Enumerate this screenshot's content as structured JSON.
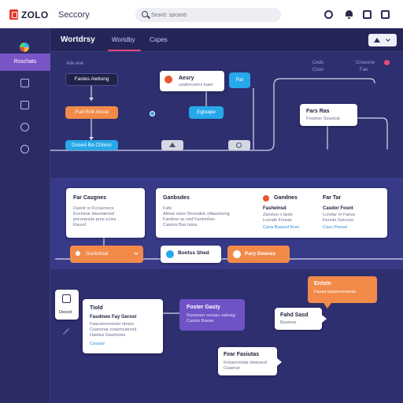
{
  "topbar": {
    "brand": "ZOLO",
    "nav_label": "Seccory",
    "search_placeholder": "Seard: spcanb"
  },
  "sidebar": {
    "active_label": "Rsschats"
  },
  "header": {
    "title": "Wortdrsy",
    "tabs": [
      {
        "label": "Wortdby"
      },
      {
        "label": "Cxpes"
      }
    ]
  },
  "canvas": {
    "lane_left": "Aite ene",
    "lane_right_a": "Ceds",
    "lane_right_b": "Coon",
    "lane_right_c": "Cnseone",
    "lane_right_d": "Fae",
    "flow": {
      "node1": "Fastes Awtiung",
      "node2": "Pud Rolt Atcoe",
      "node3": "Dosed Ba Chtenc",
      "node_top_title": "Aesry",
      "node_top_sub": "usatercoenx tuasr",
      "node_small_blue": "Par",
      "node_blue2": "Egloape",
      "node_right_title": "Fars Ras",
      "node_right_sub": "Frosiner Sosstcat"
    },
    "cards": {
      "card_left_title": "Far Casgnes",
      "card_left_lines": [
        "Dasnir or Fccusrvocs",
        "Ecemnar dacetaimed",
        "porsnanuts proe a,hxs",
        "Rausd"
      ],
      "card_left_button": "Sonlctinal",
      "card_mid_title": "Ganbsdes",
      "card_mid_lines": [
        "Fafe",
        "Atinas oneo Smoudsic oftauchuing",
        "Fandrse as ranf Fantonhes",
        "Cassne Bas teioa"
      ],
      "card_mid_right_title": "Gandnes",
      "card_mid_right_sub": "Fasheinsd",
      "card_mid_right_lines": [
        "Zanstus o tauto",
        "Lnsnde Fonsar",
        "Cana Bsaosd ftcen"
      ],
      "card_right_title": "Far Tar",
      "card_right_sub": "Casdor Fosnt",
      "card_right_lines": [
        "Lcnstar or Fanus",
        "Kenoto Sorcuss",
        "Caso Ponsst"
      ],
      "chip1": "Bontss Shed",
      "chip2": "Pary Deanss"
    },
    "lower": {
      "side_card_label": "Desod",
      "tool_title": "Tiold",
      "tool_sub_title": "Fasdmen Fay Gerost",
      "tool_lines": [
        "Faaconnnnonsir otnars",
        "Coansnar coasmcanosd",
        "Hastasi Gauhesee"
      ],
      "tool_link": "Cosasd",
      "purple_title": "Foster Gasty",
      "purple_lines": [
        "Rasseaer ossasu sakoag",
        "Casste Baeae"
      ],
      "orange_title": "Entstn",
      "orange_line": "Fauea laaasscessnas",
      "small_card_title": "Fahd Sasd",
      "small_card_sub": "Bsanear",
      "bottom_card_title": "Fear Fasiutas",
      "bottom_card_lines": [
        "Kosaconiutai otsesacd",
        "Coaenar"
      ]
    }
  },
  "colors": {
    "canvas_bg": "#2d2f6e",
    "accent_orange": "#f28a4a",
    "accent_blue": "#27a8ea",
    "accent_purple": "#6f53c6",
    "tab_underline": "#e8477a"
  }
}
